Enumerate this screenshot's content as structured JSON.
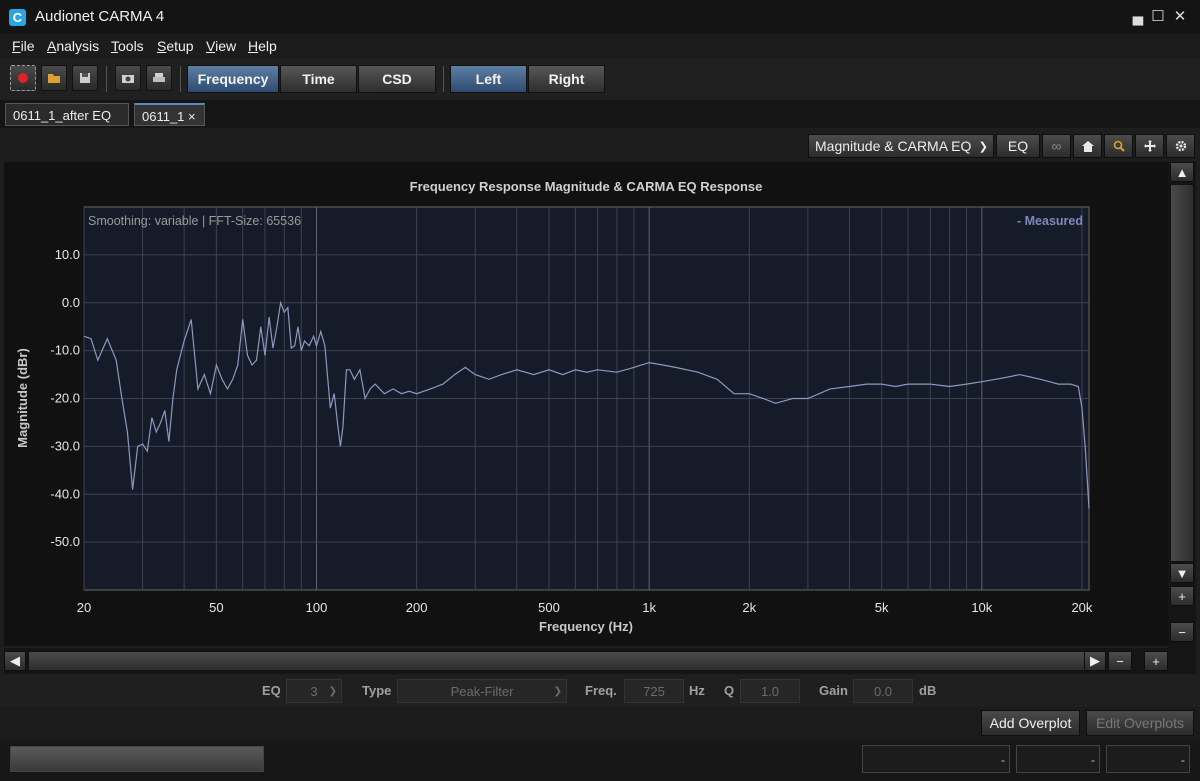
{
  "window": {
    "title": "Audionet CARMA 4",
    "icon_letter": "C"
  },
  "menu": [
    {
      "label": "File",
      "mnemonic": "F",
      "rest": "ile"
    },
    {
      "label": "Analysis",
      "mnemonic": "A",
      "rest": "nalysis"
    },
    {
      "label": "Tools",
      "mnemonic": "T",
      "rest": "ools"
    },
    {
      "label": "Setup",
      "mnemonic": "S",
      "rest": "etup"
    },
    {
      "label": "View",
      "mnemonic": "V",
      "rest": "iew"
    },
    {
      "label": "Help",
      "mnemonic": "H",
      "rest": "elp"
    }
  ],
  "toolbar": {
    "views": [
      "Frequency",
      "Time",
      "CSD"
    ],
    "active_view": "Frequency",
    "channels": [
      "Left",
      "Right"
    ],
    "active_channel": "Left"
  },
  "tabs": [
    {
      "label": "0611_1_after EQ",
      "active": false
    },
    {
      "label": "0611_1",
      "active": true,
      "close": "×"
    }
  ],
  "plot_toolbar": {
    "mode_select": "Magnitude & CARMA EQ",
    "eq_button": "EQ",
    "link_icon": "∞"
  },
  "eq_bar": {
    "eq_label": "EQ",
    "eq_value": "3",
    "type_label": "Type",
    "type_value": "Peak-Filter",
    "freq_label": "Freq.",
    "freq_value": "725",
    "freq_unit": "Hz",
    "q_label": "Q",
    "q_value": "1.0",
    "gain_label": "Gain",
    "gain_value": "0.0",
    "gain_unit": "dB"
  },
  "overplots": {
    "add": "Add Overplot",
    "edit": "Edit Overplots"
  },
  "status": {
    "field1": "-",
    "field2": "-",
    "field3": "-"
  },
  "scroll": {
    "up": "▲",
    "down": "▼",
    "left": "◀",
    "right": "▶",
    "plus": "+",
    "minus": "−"
  },
  "chart_data": {
    "type": "line",
    "title": "Frequency Response Magnitude & CARMA EQ Response",
    "info_text": "Smoothing: variable | FFT-Size: 65536",
    "xlabel": "Frequency (Hz)",
    "ylabel": "Magnitude (dBr)",
    "x_scale": "log",
    "xlim": [
      20,
      21000
    ],
    "ylim": [
      -60,
      20
    ],
    "x_ticks": [
      {
        "value": 20,
        "label": "20"
      },
      {
        "value": 50,
        "label": "50"
      },
      {
        "value": 100,
        "label": "100"
      },
      {
        "value": 200,
        "label": "200"
      },
      {
        "value": 500,
        "label": "500"
      },
      {
        "value": 1000,
        "label": "1k"
      },
      {
        "value": 2000,
        "label": "2k"
      },
      {
        "value": 5000,
        "label": "5k"
      },
      {
        "value": 10000,
        "label": "10k"
      },
      {
        "value": 20000,
        "label": "20k"
      }
    ],
    "y_ticks": [
      {
        "value": 10,
        "label": "10.0"
      },
      {
        "value": 0,
        "label": "0.0"
      },
      {
        "value": -10,
        "label": "-10.0"
      },
      {
        "value": -20,
        "label": "-20.0"
      },
      {
        "value": -30,
        "label": "-30.0"
      },
      {
        "value": -40,
        "label": "-40.0"
      },
      {
        "value": -50,
        "label": "-50.0"
      }
    ],
    "grid": true,
    "legend": {
      "position": "top-right",
      "entries": [
        "- Measured"
      ]
    },
    "colors": {
      "line": "#8f97be",
      "background": "#161b2a",
      "grid": "#3d4252",
      "grid_major": "#60646f"
    },
    "series": [
      {
        "name": "Measured",
        "x": [
          20,
          21,
          22,
          23.5,
          25,
          26,
          27,
          28,
          29,
          30,
          31,
          32,
          33,
          34,
          35,
          36,
          37,
          38,
          40,
          42,
          44,
          46,
          48,
          50,
          52,
          54,
          56,
          58,
          60,
          62,
          64,
          66,
          68,
          70,
          72,
          74,
          76,
          78,
          80,
          82,
          84,
          86,
          88,
          90,
          92,
          95,
          98,
          100,
          103,
          106,
          110,
          113,
          116,
          118,
          120,
          123,
          126,
          130,
          135,
          140,
          145,
          150,
          160,
          170,
          180,
          190,
          200,
          220,
          240,
          260,
          280,
          300,
          330,
          360,
          400,
          450,
          500,
          550,
          600,
          650,
          700,
          800,
          900,
          1000,
          1100,
          1200,
          1400,
          1600,
          1800,
          2000,
          2200,
          2400,
          2700,
          3000,
          3500,
          4000,
          4500,
          5000,
          5500,
          6000,
          7000,
          8000,
          9000,
          10000,
          11000,
          12000,
          13000,
          14000,
          15000,
          17000,
          18500,
          19500,
          20000,
          20500,
          21000
        ],
        "y": [
          -7,
          -7.5,
          -12,
          -7.5,
          -12,
          -20,
          -27,
          -39,
          -30,
          -29.5,
          -31,
          -24,
          -27,
          -25,
          -22.5,
          -29,
          -20,
          -14,
          -8,
          -3.5,
          -18,
          -15,
          -19,
          -13,
          -16,
          -18,
          -16,
          -13,
          -3.5,
          -11,
          -13,
          -12,
          -5,
          -11,
          -3,
          -9.5,
          -5,
          0,
          -2,
          -1,
          -9.5,
          -9,
          -5,
          -10,
          -8,
          -9,
          -7,
          -9,
          -6,
          -9,
          -22,
          -19,
          -26,
          -30,
          -26,
          -14,
          -14,
          -16,
          -14,
          -20,
          -18,
          -17,
          -19,
          -18,
          -19,
          -18.5,
          -19,
          -18,
          -17,
          -15,
          -13.5,
          -15,
          -16,
          -15,
          -14,
          -15,
          -14,
          -15,
          -14,
          -14.5,
          -14,
          -14.5,
          -13.5,
          -12.5,
          -13,
          -13.5,
          -14.5,
          -16,
          -19,
          -19,
          -20,
          -21,
          -20,
          -20,
          -18,
          -17.5,
          -17,
          -17,
          -17.5,
          -17,
          -17,
          -17.5,
          -17,
          -16.5,
          -16,
          -15.5,
          -15,
          -15.5,
          -16,
          -17,
          -17,
          -17.5,
          -22,
          -31,
          -43
        ]
      }
    ]
  }
}
